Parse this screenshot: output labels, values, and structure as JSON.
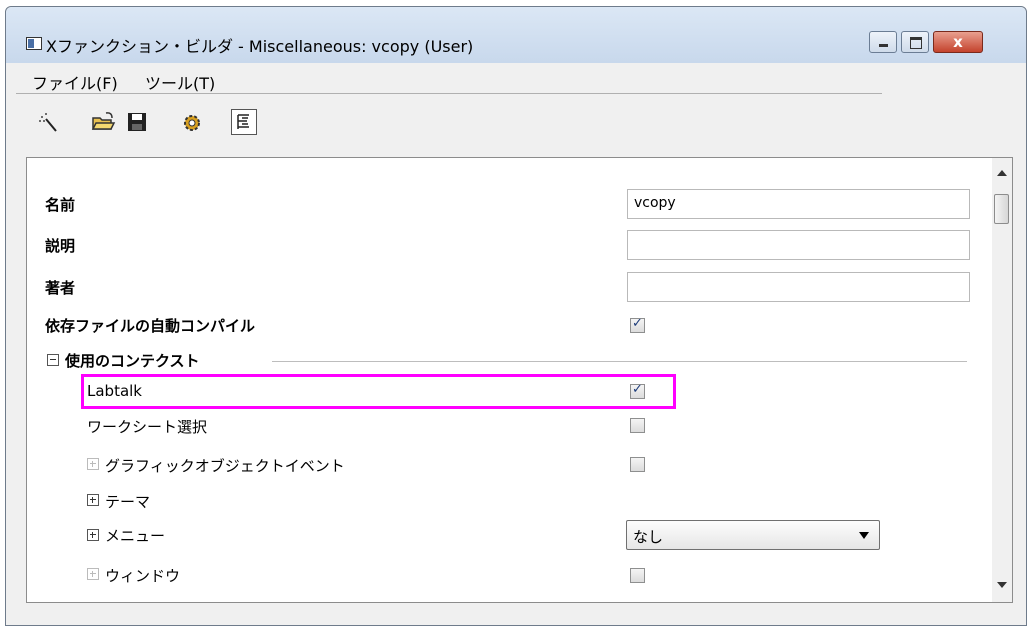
{
  "window": {
    "title": "Xファンクション・ビルダ - Miscellaneous: vcopy (User)",
    "close_glyph": "x"
  },
  "menu": {
    "items": [
      "ファイル(F)",
      "ツール(T)"
    ]
  },
  "toolbar": {
    "icons": [
      "wand-icon",
      "open-folder-icon",
      "save-icon",
      "compile-gear-icon",
      "tree-view-icon"
    ]
  },
  "properties": {
    "name_label": "名前",
    "name_value": "vcopy",
    "description_label": "説明",
    "description_value": "",
    "author_label": "著者",
    "author_value": "",
    "auto_compile_label": "依存ファイルの自動コンパイル",
    "auto_compile_checked": true,
    "context_section_label": "使用のコンテクスト",
    "labtalk_label": "Labtalk",
    "labtalk_checked": true,
    "worksheet_label": "ワークシート選択",
    "worksheet_checked": false,
    "graphic_event_label": "グラフィックオブジェクトイベント",
    "graphic_event_checked": false,
    "theme_label": "テーマ",
    "menu_label": "メニュー",
    "menu_value": "なし",
    "window_label": "ウィンドウ",
    "window_checked": false
  },
  "colors": {
    "highlight": "#ff00ff",
    "panel_bg": "#ffffff",
    "window_bg": "#f0f0f0"
  }
}
